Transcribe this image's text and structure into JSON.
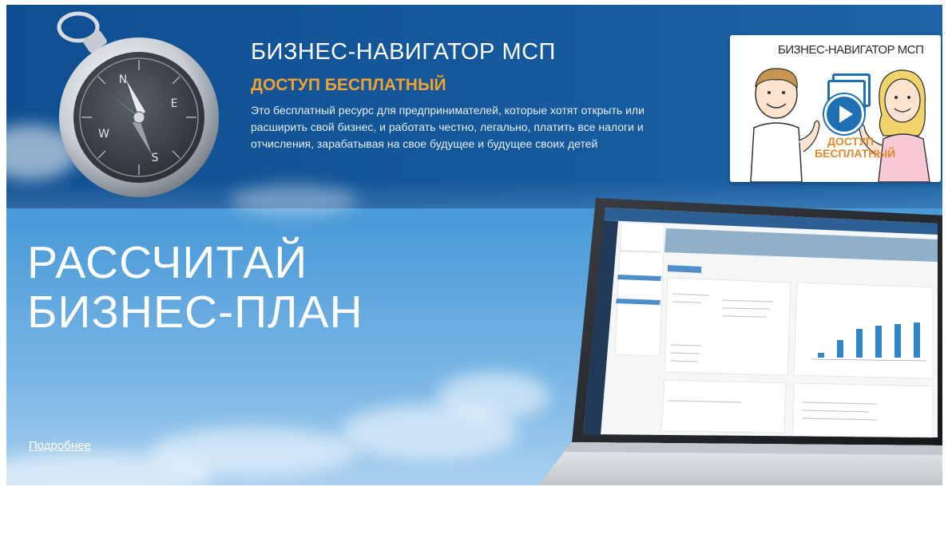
{
  "banner": {
    "site_title": "БИЗНЕС-НАВИГАТОР МСП",
    "access_label": "ДОСТУП БЕСПЛАТНЫЙ",
    "description": "Это бесплатный ресурс для предпринимателей, которые хотят открыть или расширить свой бизнес, и работать честно, легально, платить все налоги и отчисления, зарабатывая на свое будущее и будущее своих детей"
  },
  "video_card": {
    "title": "БИЗНЕС-НАВИГАТОР МСП",
    "subtitle": "ДОСТУП БЕСПЛАТНЫЙ",
    "icon": "play-icon"
  },
  "hero": {
    "title_line1": "РАССЧИТАЙ",
    "title_line2": "БИЗНЕС-ПЛАН",
    "more_link": "Подробнее"
  },
  "colors": {
    "top_band": "#15599c",
    "accent_orange": "#f2a230",
    "sky": "#4a9ad8",
    "play_blue": "#1f6fb3"
  }
}
